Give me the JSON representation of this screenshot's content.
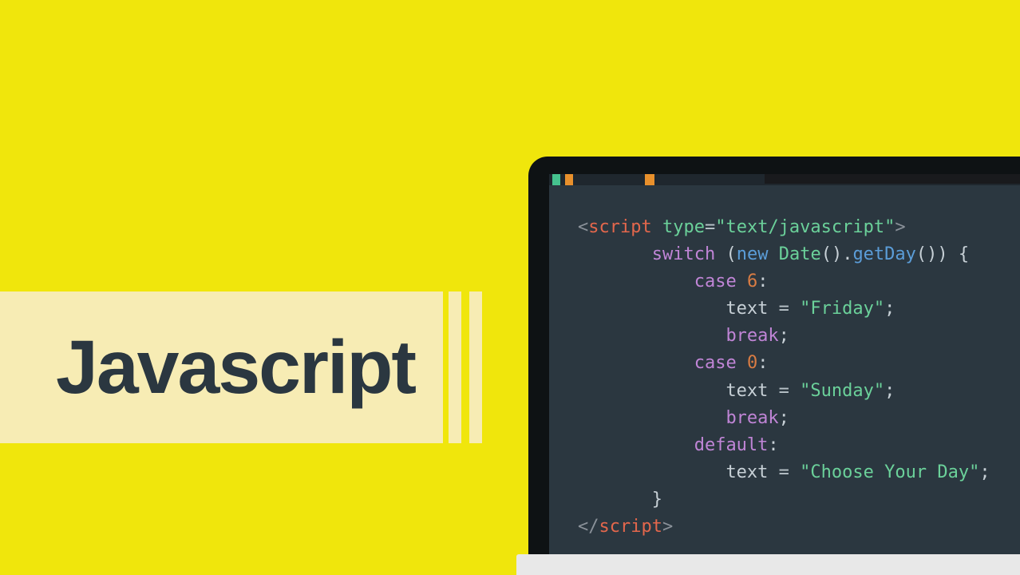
{
  "title": "Javascript",
  "code": {
    "line1": {
      "open": "<",
      "tag": "script",
      "space": " ",
      "attr": "type",
      "eq": "=",
      "val": "\"text/javascript\"",
      "close": ">"
    },
    "line2": {
      "kw": "switch",
      "space": " ",
      "lp": "(",
      "new": "new",
      "space2": " ",
      "cls": "Date",
      "lp2": "(",
      "rp2": ")",
      "dot": ".",
      "method": "getDay",
      "lp3": "(",
      "rp3": ")",
      "rp": ")",
      "space3": " ",
      "lb": "{"
    },
    "line3": {
      "kw": "case",
      "space": " ",
      "num": "6",
      "colon": ":"
    },
    "line4": {
      "ident": "text",
      "space": " ",
      "eq": "=",
      "space2": " ",
      "str": "\"Friday\"",
      "semi": ";"
    },
    "line5": {
      "kw": "break",
      "semi": ";"
    },
    "line6": {
      "kw": "case",
      "space": " ",
      "num": "0",
      "colon": ":"
    },
    "line7": {
      "ident": "text",
      "space": " ",
      "eq": "=",
      "space2": " ",
      "str": "\"Sunday\"",
      "semi": ";"
    },
    "line8": {
      "kw": "break",
      "semi": ";"
    },
    "line9": {
      "kw": "default",
      "colon": ":"
    },
    "line10": {
      "ident": "text",
      "space": " ",
      "eq": "=",
      "space2": " ",
      "str": "\"Choose Your Day\"",
      "semi": ";"
    },
    "line11": {
      "rb": "}"
    },
    "line12": {
      "open": "<",
      "slash": "/",
      "tag": "script",
      "close": ">"
    }
  }
}
